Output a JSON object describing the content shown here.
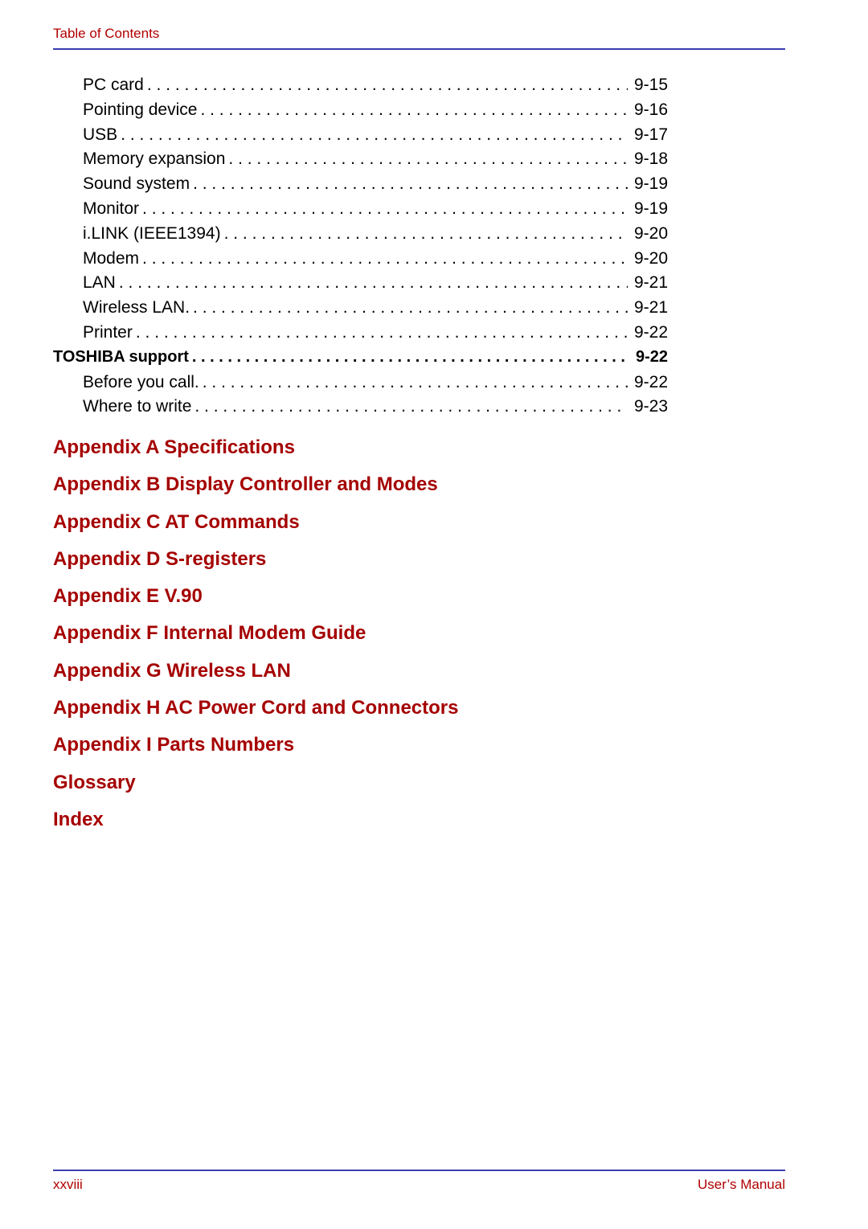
{
  "header": {
    "title": "Table of Contents"
  },
  "toc_entries": [
    {
      "label": "PC card",
      "page": "9-15",
      "level": "sub"
    },
    {
      "label": "Pointing device",
      "page": "9-16",
      "level": "sub"
    },
    {
      "label": "USB",
      "page": "9-17",
      "level": "sub"
    },
    {
      "label": "Memory expansion",
      "page": "9-18",
      "level": "sub"
    },
    {
      "label": "Sound system",
      "page": "9-19",
      "level": "sub"
    },
    {
      "label": "Monitor",
      "page": "9-19",
      "level": "sub"
    },
    {
      "label": "i.LINK (IEEE1394)",
      "page": "9-20",
      "level": "sub"
    },
    {
      "label": "Modem",
      "page": "9-20",
      "level": "sub"
    },
    {
      "label": "LAN",
      "page": "9-21",
      "level": "sub"
    },
    {
      "label": "Wireless LAN.",
      "page": "9-21",
      "level": "sub"
    },
    {
      "label": "Printer",
      "page": "9-22",
      "level": "sub"
    },
    {
      "label": "TOSHIBA support",
      "page": "9-22",
      "level": "section"
    },
    {
      "label": "Before you call.",
      "page": "9-22",
      "level": "sub"
    },
    {
      "label": "Where to write",
      "page": "9-23",
      "level": "sub"
    }
  ],
  "appendices": [
    "Appendix A Specifications",
    "Appendix B Display Controller and Modes",
    "Appendix C AT Commands",
    "Appendix D S-registers",
    "Appendix E V.90",
    "Appendix F Internal Modem Guide",
    "Appendix G Wireless LAN",
    "Appendix H AC Power Cord and Connectors",
    "Appendix I Parts Numbers",
    "Glossary",
    "Index"
  ],
  "footer": {
    "page_number": "xxviii",
    "manual_title": "User’s Manual"
  },
  "colors": {
    "accent_red": "#a50000",
    "rule_blue": "#3a3fb0"
  }
}
